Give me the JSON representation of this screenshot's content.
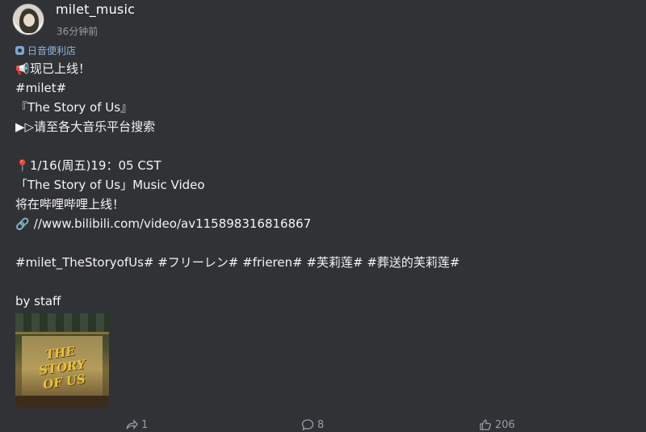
{
  "header": {
    "username": "milet_music",
    "timestamp": "36分钟前",
    "source": "日音便利店"
  },
  "content": {
    "lines": [
      "现已上线！",
      "#milet#",
      "『The Story of Us』",
      "▶▷请至各大音乐平台搜索",
      "",
      "1/16(周五)19：05 CST",
      "「The Story of Us」Music Video",
      "将在哔哩哔哩上线！",
      "//www.bilibili.com/video/av115898316816867",
      "",
      "#milet_TheStoryofUs# #フリーレン# #frieren# #芙莉莲# #葬送的芙莉莲#",
      "",
      "by staff"
    ],
    "icons": {
      "line0": "megaphone-icon",
      "line5": "pin-icon",
      "line8": "link-icon"
    }
  },
  "thumbnail": {
    "art_text_1": "THE",
    "art_text_2": "STORY",
    "art_text_3": "OF US"
  },
  "actions": {
    "repost_count": "1",
    "comment_count": "8",
    "like_count": "206"
  },
  "colors": {
    "background": "#313236",
    "text": "#f4f4f4",
    "muted": "#9a9ca3",
    "source": "#8fb3d9"
  }
}
